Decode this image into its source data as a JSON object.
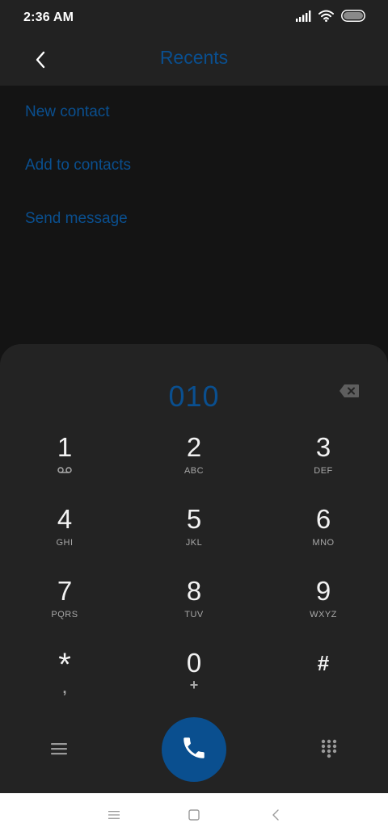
{
  "status_bar": {
    "time": "2:36 AM",
    "icons": [
      "signal-icon",
      "wifi-icon",
      "battery-icon"
    ]
  },
  "header": {
    "back_icon": "chevron-left-icon",
    "title": "Recents"
  },
  "actions": [
    {
      "label": "New contact"
    },
    {
      "label": "Add to contacts"
    },
    {
      "label": "Send message"
    }
  ],
  "dialer": {
    "number": "010",
    "backspace_icon": "backspace-icon",
    "keys": [
      {
        "digit": "1",
        "letters": "",
        "sub_icon": "voicemail-icon"
      },
      {
        "digit": "2",
        "letters": "ABC"
      },
      {
        "digit": "3",
        "letters": "DEF"
      },
      {
        "digit": "4",
        "letters": "GHI"
      },
      {
        "digit": "5",
        "letters": "JKL"
      },
      {
        "digit": "6",
        "letters": "MNO"
      },
      {
        "digit": "7",
        "letters": "PQRS"
      },
      {
        "digit": "8",
        "letters": "TUV"
      },
      {
        "digit": "9",
        "letters": "WXYZ"
      },
      {
        "digit": "*",
        "letters": ","
      },
      {
        "digit": "0",
        "letters": "+"
      },
      {
        "digit": "#",
        "letters": ""
      }
    ],
    "bottom": {
      "menu_icon": "hamburger-menu-icon",
      "call_icon": "phone-icon",
      "keypad_icon": "dialpad-icon"
    }
  },
  "nav_bar": {
    "icons": [
      "recents-menu-icon",
      "home-square-icon",
      "back-triangle-icon"
    ]
  },
  "colors": {
    "accent": "#0a4f8f",
    "background": "#141414",
    "panel": "#232323",
    "header": "#222222"
  }
}
